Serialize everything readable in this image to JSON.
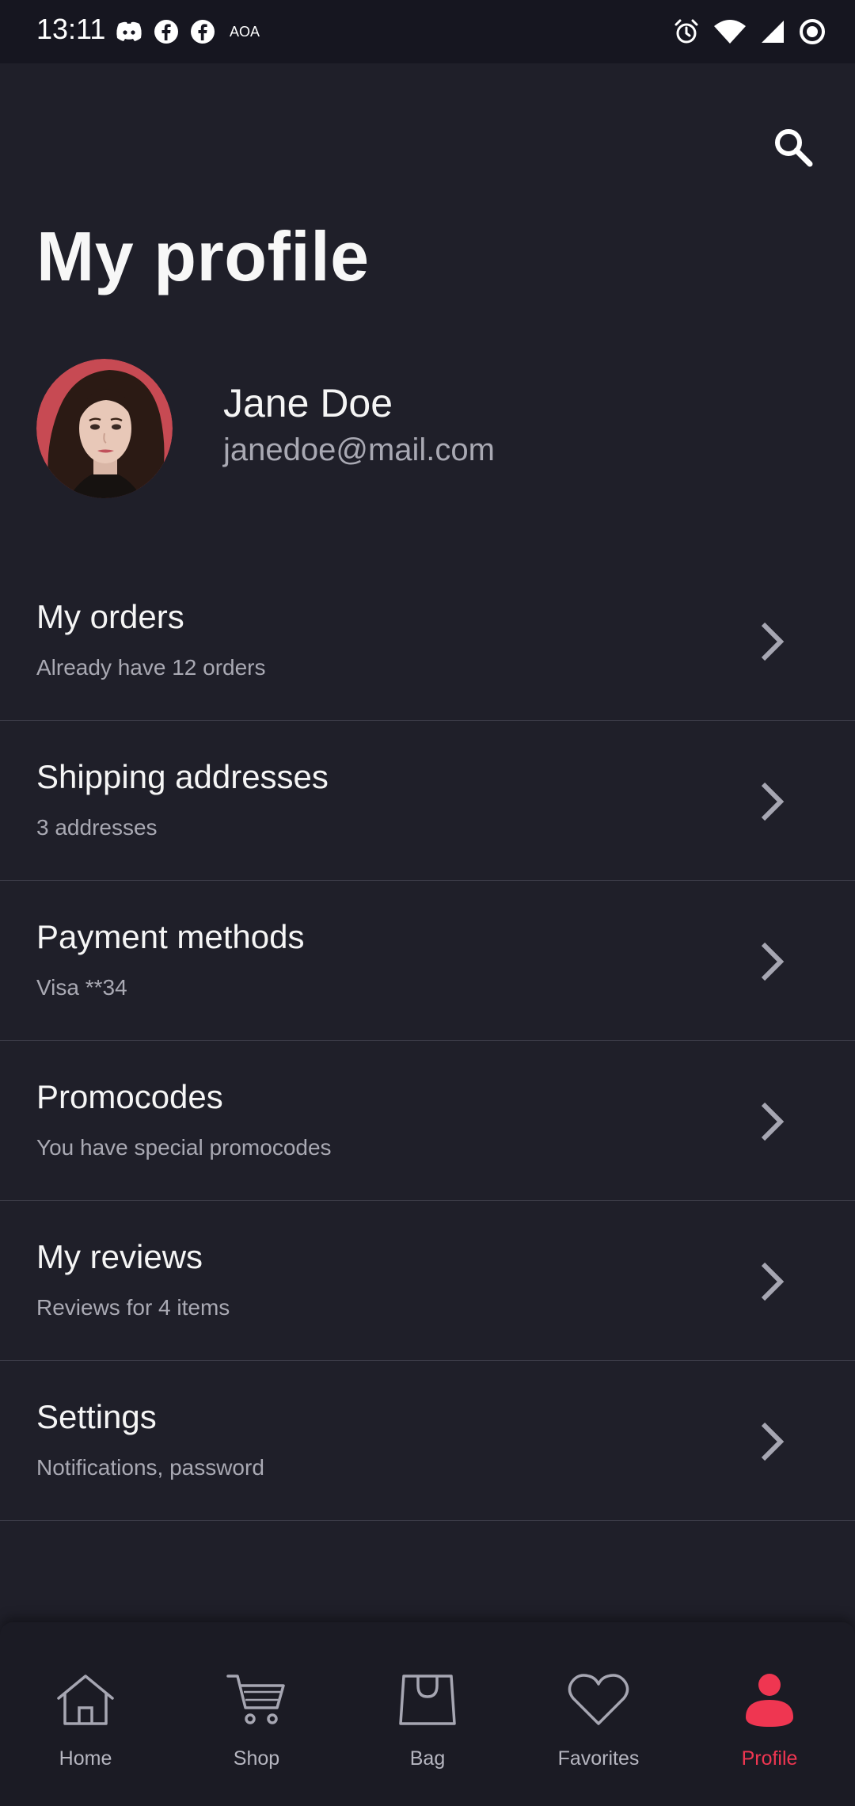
{
  "status_bar": {
    "time": "13:11",
    "carrier": "AOA",
    "left_icons": [
      "discord-icon",
      "facebook-icon",
      "facebook-icon"
    ],
    "right_icons": [
      "alarm-icon",
      "wifi-icon",
      "signal-icon",
      "record-icon"
    ]
  },
  "header": {
    "title": "My profile",
    "search_icon": "search-icon"
  },
  "profile": {
    "name": "Jane Doe",
    "email": "janedoe@mail.com"
  },
  "menu": {
    "items": [
      {
        "title": "My orders",
        "subtitle": "Already have 12 orders"
      },
      {
        "title": "Shipping addresses",
        "subtitle": "3 addresses"
      },
      {
        "title": "Payment methods",
        "subtitle": "Visa **34"
      },
      {
        "title": "Promocodes",
        "subtitle": "You have special promocodes"
      },
      {
        "title": "My reviews",
        "subtitle": "Reviews for 4 items"
      },
      {
        "title": "Settings",
        "subtitle": "Notifications, password"
      }
    ]
  },
  "bottom_nav": {
    "items": [
      {
        "label": "Home",
        "icon": "home-icon"
      },
      {
        "label": "Shop",
        "icon": "cart-icon"
      },
      {
        "label": "Bag",
        "icon": "bag-icon"
      },
      {
        "label": "Favorites",
        "icon": "heart-icon"
      },
      {
        "label": "Profile",
        "icon": "person-icon"
      }
    ],
    "active": "Profile"
  },
  "colors": {
    "background": "#1f1f29",
    "accent": "#ef3651",
    "text_primary": "#f5f5f5",
    "text_secondary": "#a9a9b3",
    "divider": "#3c3c48"
  }
}
